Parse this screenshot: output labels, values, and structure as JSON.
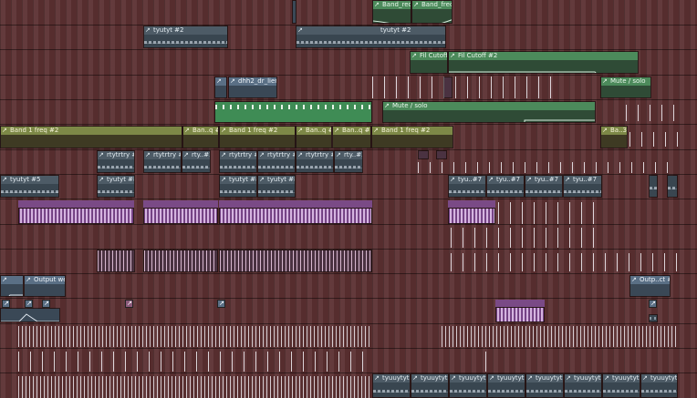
{
  "playlist": {
    "clips": {
      "band_freq_a": "Band_req",
      "band_freq_b": "Band_freq",
      "tyu_a": "tyutyt #2",
      "tyu_b": "tyutyt #2",
      "fil_a": "Fil Cutoff",
      "fil_b": "Fil Cutoff #2",
      "dhh": "dhh2_dr_lier",
      "mute_a": "Mute / solo",
      "mute_b": "Mute / solo",
      "band1_a": "Band 1 freq #2",
      "band1_b": "Ban..q #2",
      "band1_c": "Band 1 freq #2",
      "band1_d": "Ban..q #2",
      "band1_e": "Ban..q #2",
      "band1_f": "Band 1 freq #2",
      "band1_g": "Ba..3",
      "r1": "rtytrtry #2",
      "r2": "rtytrtry #3",
      "r3": "rty..#3",
      "r4": "rtytrtry #2",
      "r5": "rtytrtry #2",
      "r6": "rtytrtry #2",
      "r7": "rty..#3",
      "t1": "tyutyt #5",
      "t2": "tyutyt #8",
      "t3": "tyutyt #8",
      "t4": "tyutyt #8",
      "t5": "tyu..#7",
      "t6": "tyu..#7",
      "t7": "tyu..#7",
      "t8": "tyu..#7",
      "out_a": "Output wet",
      "out_b": "Outp..ct #2",
      "b1": "tyuuytyt",
      "b2": "tyuuytyt",
      "b3": "tyuuytyt",
      "b4": "tyuuytyt",
      "b5": "tyuuytyt",
      "b6": "tyuuytyt",
      "b7": "tyuuytyt",
      "b8": "tyuuytyt"
    }
  },
  "colors": {
    "background": "#5b3031",
    "pattern": "#4d5b66",
    "automation_yellow": "#7d8847",
    "automation_green": "#4c8a5b",
    "waveform": "#d9bfe0"
  }
}
